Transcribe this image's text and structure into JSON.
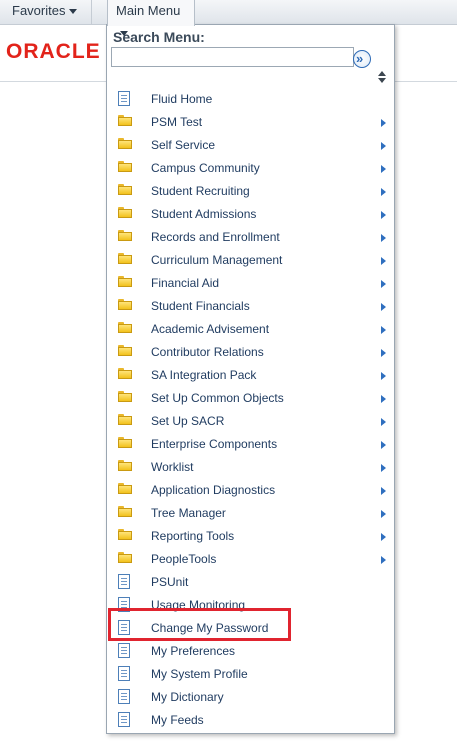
{
  "nav": {
    "favorites": "Favorites",
    "main_menu": "Main Menu"
  },
  "header": {
    "logo": "ORACLE"
  },
  "search": {
    "title": "Search Menu:",
    "placeholder": "",
    "go": "»"
  },
  "accent_color": "#e0242f",
  "menu_items": [
    {
      "label": "Fluid Home",
      "type": "doc",
      "submenu": false
    },
    {
      "label": "PSM Test",
      "type": "folder",
      "submenu": true
    },
    {
      "label": "Self Service",
      "type": "folder",
      "submenu": true
    },
    {
      "label": "Campus Community",
      "type": "folder",
      "submenu": true
    },
    {
      "label": "Student Recruiting",
      "type": "folder",
      "submenu": true
    },
    {
      "label": "Student Admissions",
      "type": "folder",
      "submenu": true
    },
    {
      "label": "Records and Enrollment",
      "type": "folder",
      "submenu": true
    },
    {
      "label": "Curriculum Management",
      "type": "folder",
      "submenu": true
    },
    {
      "label": "Financial Aid",
      "type": "folder",
      "submenu": true
    },
    {
      "label": "Student Financials",
      "type": "folder",
      "submenu": true
    },
    {
      "label": "Academic Advisement",
      "type": "folder",
      "submenu": true
    },
    {
      "label": "Contributor Relations",
      "type": "folder",
      "submenu": true
    },
    {
      "label": "SA Integration Pack",
      "type": "folder",
      "submenu": true
    },
    {
      "label": "Set Up Common Objects",
      "type": "folder",
      "submenu": true
    },
    {
      "label": "Set Up SACR",
      "type": "folder",
      "submenu": true
    },
    {
      "label": "Enterprise Components",
      "type": "folder",
      "submenu": true
    },
    {
      "label": "Worklist",
      "type": "folder",
      "submenu": true
    },
    {
      "label": "Application Diagnostics",
      "type": "folder",
      "submenu": true
    },
    {
      "label": "Tree Manager",
      "type": "folder",
      "submenu": true
    },
    {
      "label": "Reporting Tools",
      "type": "folder",
      "submenu": true
    },
    {
      "label": "PeopleTools",
      "type": "folder",
      "submenu": true
    },
    {
      "label": "PSUnit",
      "type": "doc",
      "submenu": false
    },
    {
      "label": "Usage Monitoring",
      "type": "doc",
      "submenu": false
    },
    {
      "label": "Change My Password",
      "type": "doc",
      "submenu": false
    },
    {
      "label": "My Preferences",
      "type": "doc",
      "submenu": false
    },
    {
      "label": "My System Profile",
      "type": "doc",
      "submenu": false
    },
    {
      "label": "My Dictionary",
      "type": "doc",
      "submenu": false
    },
    {
      "label": "My Feeds",
      "type": "doc",
      "submenu": false
    }
  ]
}
